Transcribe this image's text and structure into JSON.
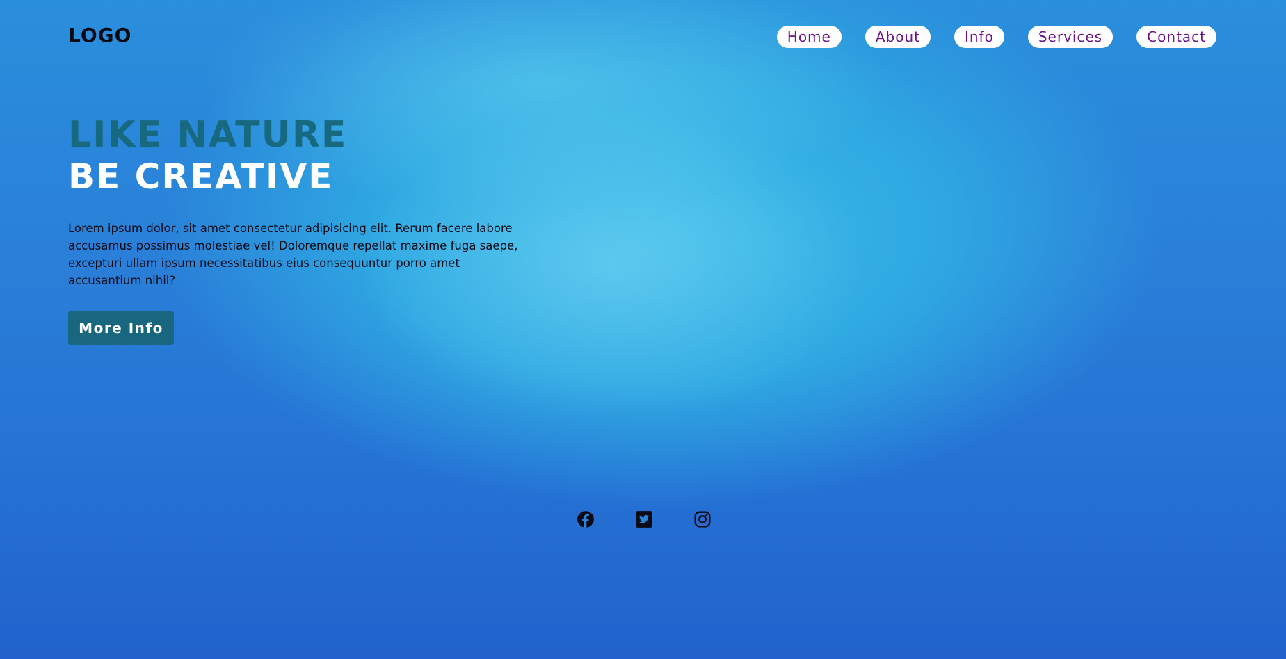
{
  "header": {
    "logo": "LOGO",
    "nav": [
      {
        "label": "Home"
      },
      {
        "label": "About"
      },
      {
        "label": "Info"
      },
      {
        "label": "Services"
      },
      {
        "label": "Contact"
      }
    ]
  },
  "hero": {
    "title_line1": "LIKE NATURE",
    "title_line2": "BE CREATIVE",
    "body": "Lorem ipsum dolor, sit amet consectetur adipisicing elit. Rerum facere labore accusamus possimus molestiae vel! Doloremque repellat maxime fuga saepe, excepturi ullam ipsum necessitatibus eius consequuntur porro amet accusantium nihil?",
    "button_label": "More Info"
  },
  "social": [
    {
      "icon": "facebook-icon"
    },
    {
      "icon": "twitter-icon"
    },
    {
      "icon": "instagram-icon"
    }
  ],
  "colors": {
    "nav_text": "#6b1688",
    "title_accent": "#17697f",
    "button_bg": "#19677f"
  }
}
